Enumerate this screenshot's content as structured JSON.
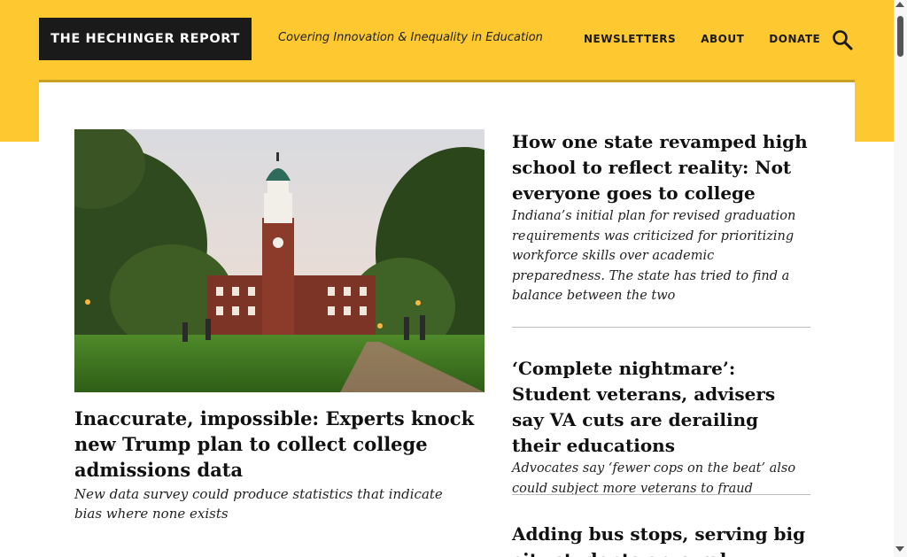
{
  "site": {
    "logo_text": "THE HECHINGER REPORT",
    "tagline": "Covering Innovation & Inequality in Education"
  },
  "nav": {
    "items": [
      {
        "label": "NEWSLETTERS"
      },
      {
        "label": "ABOUT"
      },
      {
        "label": "DONATE"
      }
    ],
    "search_icon": "search-icon"
  },
  "colors": {
    "brand_yellow": "#fdc830",
    "logo_bg": "#1a1a1a",
    "rule_gold": "#c9a024"
  },
  "feature": {
    "image": "campus-clock-tower-photo",
    "title": "Inaccurate, impossible: Experts knock new Trump plan to collect college admissions data",
    "dek": "New data survey could produce statistics that indicate bias where none exists"
  },
  "stories": [
    {
      "title": "How one state revamped high school to reflect reality: Not everyone goes to college",
      "dek": "Indiana’s initial plan for revised graduation requirements was criticized for prioritizing workforce skills over academic preparedness. The state has tried to find a balance between the two"
    },
    {
      "title": "‘Complete nightmare’: Student veterans, advisers say VA cuts are derailing their educations",
      "dek": "Advocates say ‘fewer cops on the beat’ also could subject more veterans to fraud"
    },
    {
      "title": "Adding bus stops, serving big city students on rural",
      "dek": ""
    }
  ]
}
